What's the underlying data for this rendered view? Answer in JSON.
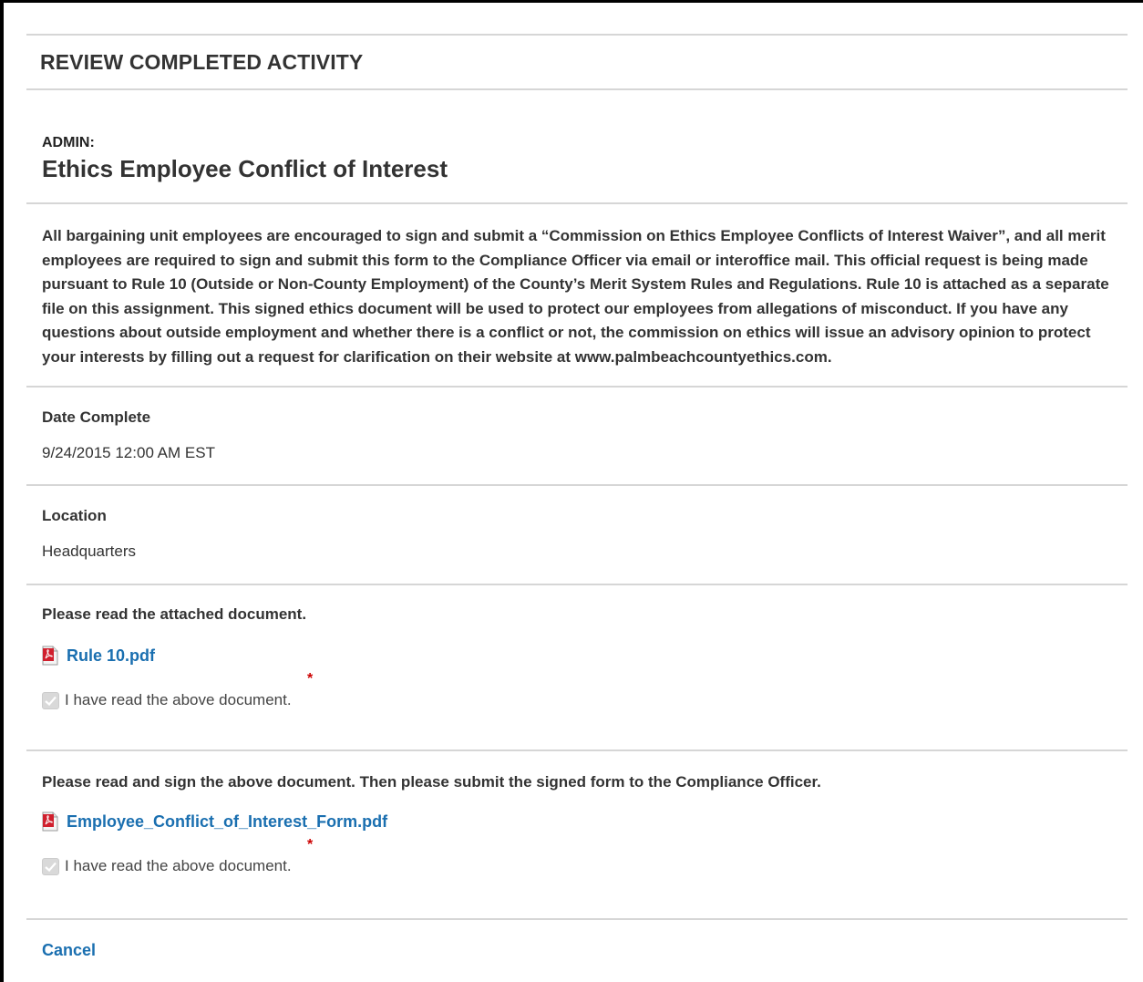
{
  "header": {
    "title": "REVIEW COMPLETED ACTIVITY"
  },
  "activity": {
    "admin_label": "ADMIN:",
    "title": "Ethics Employee Conflict of Interest",
    "description": "All bargaining unit employees are encouraged to sign and submit a “Commission on Ethics Employee Conflicts of Interest Waiver”, and all merit employees are required to sign and submit this form to the Compliance Officer via email or interoffice mail. This official request is being made pursuant to Rule 10 (Outside or Non-County Employment) of the County’s Merit System Rules and Regulations. Rule 10 is attached as a separate file on this assignment. This signed ethics document will be used to protect our employees from allegations of misconduct. If you have any questions about outside employment and whether there is a conflict or not, the commission on ethics will issue an advisory opinion to protect your interests by filling out a request for clarification on their website at www.palmbeachcountyethics.com."
  },
  "date_complete": {
    "label": "Date Complete",
    "value": "9/24/2015 12:00 AM EST"
  },
  "location": {
    "label": "Location",
    "value": "Headquarters"
  },
  "documents": [
    {
      "instruction": "Please read the attached document.",
      "file_name": "Rule 10.pdf",
      "file_icon": "pdf-icon",
      "ack_text": "I have read the above document.",
      "ack_checked": true,
      "required_mark": "*"
    },
    {
      "instruction": "Please read and sign the above document. Then please submit the signed form to the Compliance Officer.",
      "file_name": "Employee_Conflict_of_Interest_Form.pdf",
      "file_icon": "pdf-icon",
      "ack_text": "I have read the above document.",
      "ack_checked": true,
      "required_mark": "*"
    }
  ],
  "footer": {
    "cancel_label": "Cancel"
  },
  "colors": {
    "link": "#1a6fb0",
    "required": "#cc0000",
    "divider": "#d6d6d6",
    "pdf_red": "#d0202e"
  }
}
